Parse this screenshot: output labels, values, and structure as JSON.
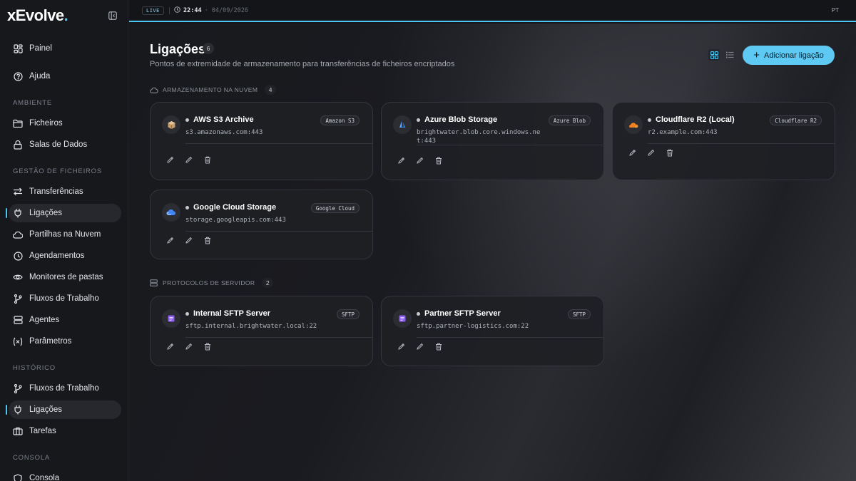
{
  "app": {
    "brand": "xEvolve",
    "brand_dot": "."
  },
  "topbar": {
    "live": "LIVE",
    "time": "22:44",
    "date": "· 04/09/2026",
    "language": "PT"
  },
  "sidebar": {
    "items": [
      {
        "label": "Painel",
        "icon": "dashboard-icon"
      },
      {
        "label": "Ajuda",
        "icon": "help-icon"
      }
    ],
    "sections": [
      {
        "title": "AMBIENTE",
        "items": [
          {
            "label": "Ficheiros",
            "icon": "folder-icon"
          },
          {
            "label": "Salas de Dados",
            "icon": "lock-icon"
          }
        ]
      },
      {
        "title": "GESTÃO DE FICHEIROS",
        "items": [
          {
            "label": "Transferências",
            "icon": "transfer-icon"
          },
          {
            "label": "Ligações",
            "icon": "plug-icon",
            "active": true
          },
          {
            "label": "Partilhas na Nuvem",
            "icon": "cloud-icon"
          },
          {
            "label": "Agendamentos",
            "icon": "clock-icon"
          },
          {
            "label": "Monitores de pastas",
            "icon": "eye-icon"
          },
          {
            "label": "Fluxos de Trabalho",
            "icon": "workflow-icon"
          },
          {
            "label": "Agentes",
            "icon": "server-icon"
          },
          {
            "label": "Parâmetros",
            "icon": "variable-icon"
          }
        ]
      },
      {
        "title": "HISTÓRICO",
        "items": [
          {
            "label": "Fluxos de Trabalho",
            "icon": "workflow-icon"
          },
          {
            "label": "Ligações",
            "icon": "plug-icon",
            "active": true
          },
          {
            "label": "Tarefas",
            "icon": "briefcase-icon"
          }
        ]
      },
      {
        "title": "CONSOLA",
        "items": [
          {
            "label": "Consola",
            "icon": "shield-icon"
          }
        ]
      }
    ]
  },
  "page": {
    "title": "Ligações",
    "count": "6",
    "subtitle": "Pontos de extremidade de armazenamento para transferências de ficheiros encriptados",
    "add_button": "Adicionar ligação"
  },
  "cloud_section": {
    "title": "ARMAZENAMENTO NA NUVEM",
    "count": "4",
    "cards": [
      {
        "name": "AWS S3 Archive",
        "type": "Amazon S3",
        "host": "s3.amazonaws.com:443",
        "logo": "aws-s3-icon",
        "color": "#c89b6a"
      },
      {
        "name": "Azure Blob Storage",
        "type": "Azure Blob",
        "host": "brightwater.blob.core.windows.net:443",
        "logo": "azure-icon",
        "color": "#3b82f6"
      },
      {
        "name": "Cloudflare R2 (Local)",
        "type": "Cloudflare R2",
        "host": "r2.example.com:443",
        "logo": "cloudflare-icon",
        "color": "#f38020"
      },
      {
        "name": "Google Cloud Storage",
        "type": "Google Cloud",
        "host": "storage.googleapis.com:443",
        "logo": "google-cloud-icon",
        "color": "#4285f4"
      }
    ]
  },
  "server_section": {
    "title": "PROTOCOLOS DE SERVIDOR",
    "count": "2",
    "cards": [
      {
        "name": "Internal SFTP Server",
        "type": "SFTP",
        "host": "sftp.internal.brightwater.local:22",
        "logo": "sftp-icon",
        "color": "#8b5cf6"
      },
      {
        "name": "Partner SFTP Server",
        "type": "SFTP",
        "host": "sftp.partner-logistics.com:22",
        "logo": "sftp-icon",
        "color": "#8b5cf6"
      }
    ]
  },
  "colors": {
    "accent": "#4cc6f2",
    "button": "#5ec9f3"
  }
}
